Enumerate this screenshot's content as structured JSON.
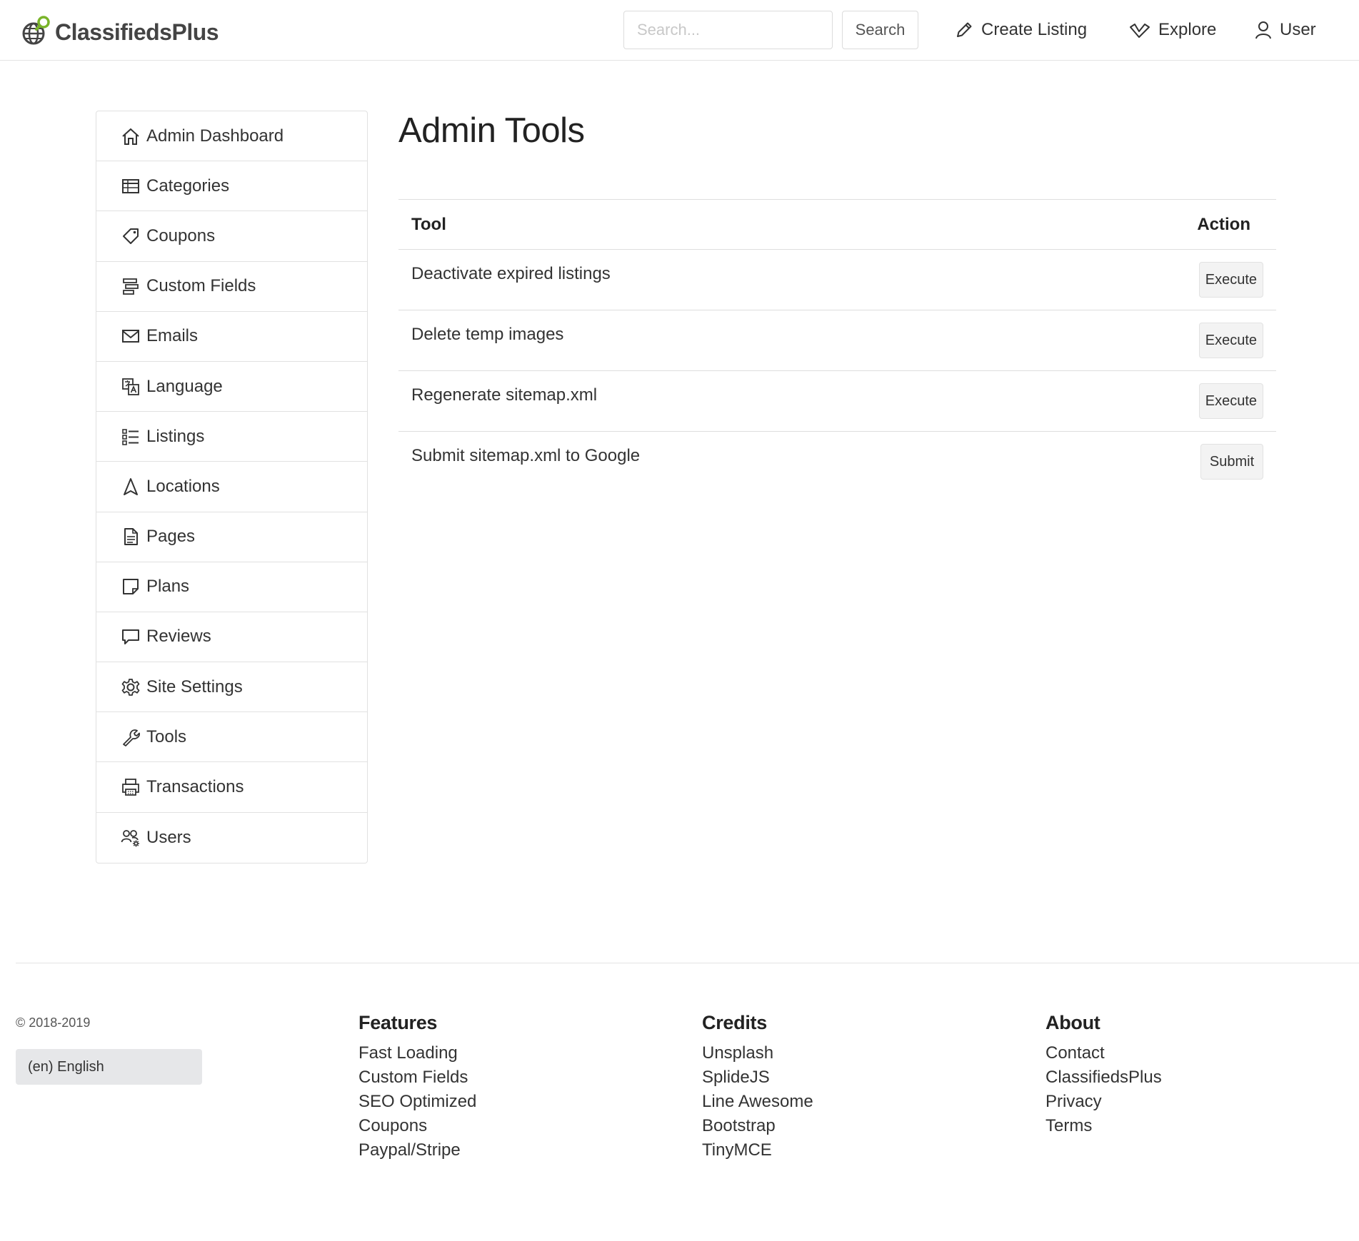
{
  "header": {
    "logo_text": "ClassifiedsPlus",
    "search_placeholder": "Search...",
    "search_button": "Search",
    "nav": [
      {
        "label": "Create Listing",
        "icon": "pencil-icon"
      },
      {
        "label": "Explore",
        "icon": "check-icon"
      },
      {
        "label": "User",
        "icon": "user-icon"
      }
    ]
  },
  "sidebar": {
    "items": [
      {
        "label": "Admin Dashboard",
        "icon": "home-icon"
      },
      {
        "label": "Categories",
        "icon": "table-icon"
      },
      {
        "label": "Coupons",
        "icon": "tags-icon"
      },
      {
        "label": "Custom Fields",
        "icon": "fields-icon"
      },
      {
        "label": "Emails",
        "icon": "envelope-icon"
      },
      {
        "label": "Language",
        "icon": "translate-icon"
      },
      {
        "label": "Listings",
        "icon": "list-icon"
      },
      {
        "label": "Locations",
        "icon": "location-arrow-icon"
      },
      {
        "label": "Pages",
        "icon": "file-icon"
      },
      {
        "label": "Plans",
        "icon": "sticky-note-icon"
      },
      {
        "label": "Reviews",
        "icon": "comment-icon"
      },
      {
        "label": "Site Settings",
        "icon": "cog-icon"
      },
      {
        "label": "Tools",
        "icon": "wrench-icon"
      },
      {
        "label": "Transactions",
        "icon": "printer-icon"
      },
      {
        "label": "Users",
        "icon": "users-cog-icon"
      }
    ]
  },
  "main": {
    "title": "Admin Tools",
    "table": {
      "headers": [
        "Tool",
        "Action"
      ],
      "rows": [
        {
          "tool": "Deactivate expired listings",
          "action": "Execute"
        },
        {
          "tool": "Delete temp images",
          "action": "Execute"
        },
        {
          "tool": "Regenerate sitemap.xml",
          "action": "Execute"
        },
        {
          "tool": "Submit sitemap.xml to Google",
          "action": "Submit"
        }
      ]
    }
  },
  "footer": {
    "copyright": "© 2018-2019",
    "language": "(en) English",
    "columns": [
      {
        "title": "Features",
        "links": [
          "Fast Loading",
          "Custom Fields",
          "SEO Optimized",
          "Coupons",
          "Paypal/Stripe"
        ]
      },
      {
        "title": "Credits",
        "links": [
          "Unsplash",
          "SplideJS",
          "Line Awesome",
          "Bootstrap",
          "TinyMCE"
        ]
      },
      {
        "title": "About",
        "links": [
          "Contact",
          "ClassifiedsPlus",
          "Privacy",
          "Terms"
        ]
      }
    ]
  },
  "colors": {
    "logo_green": "#7ab42a",
    "logo_gray": "#444444",
    "button_bg": "#f3f3f3",
    "select_bg": "#e6e7e9",
    "border": "#e1e1e1"
  }
}
